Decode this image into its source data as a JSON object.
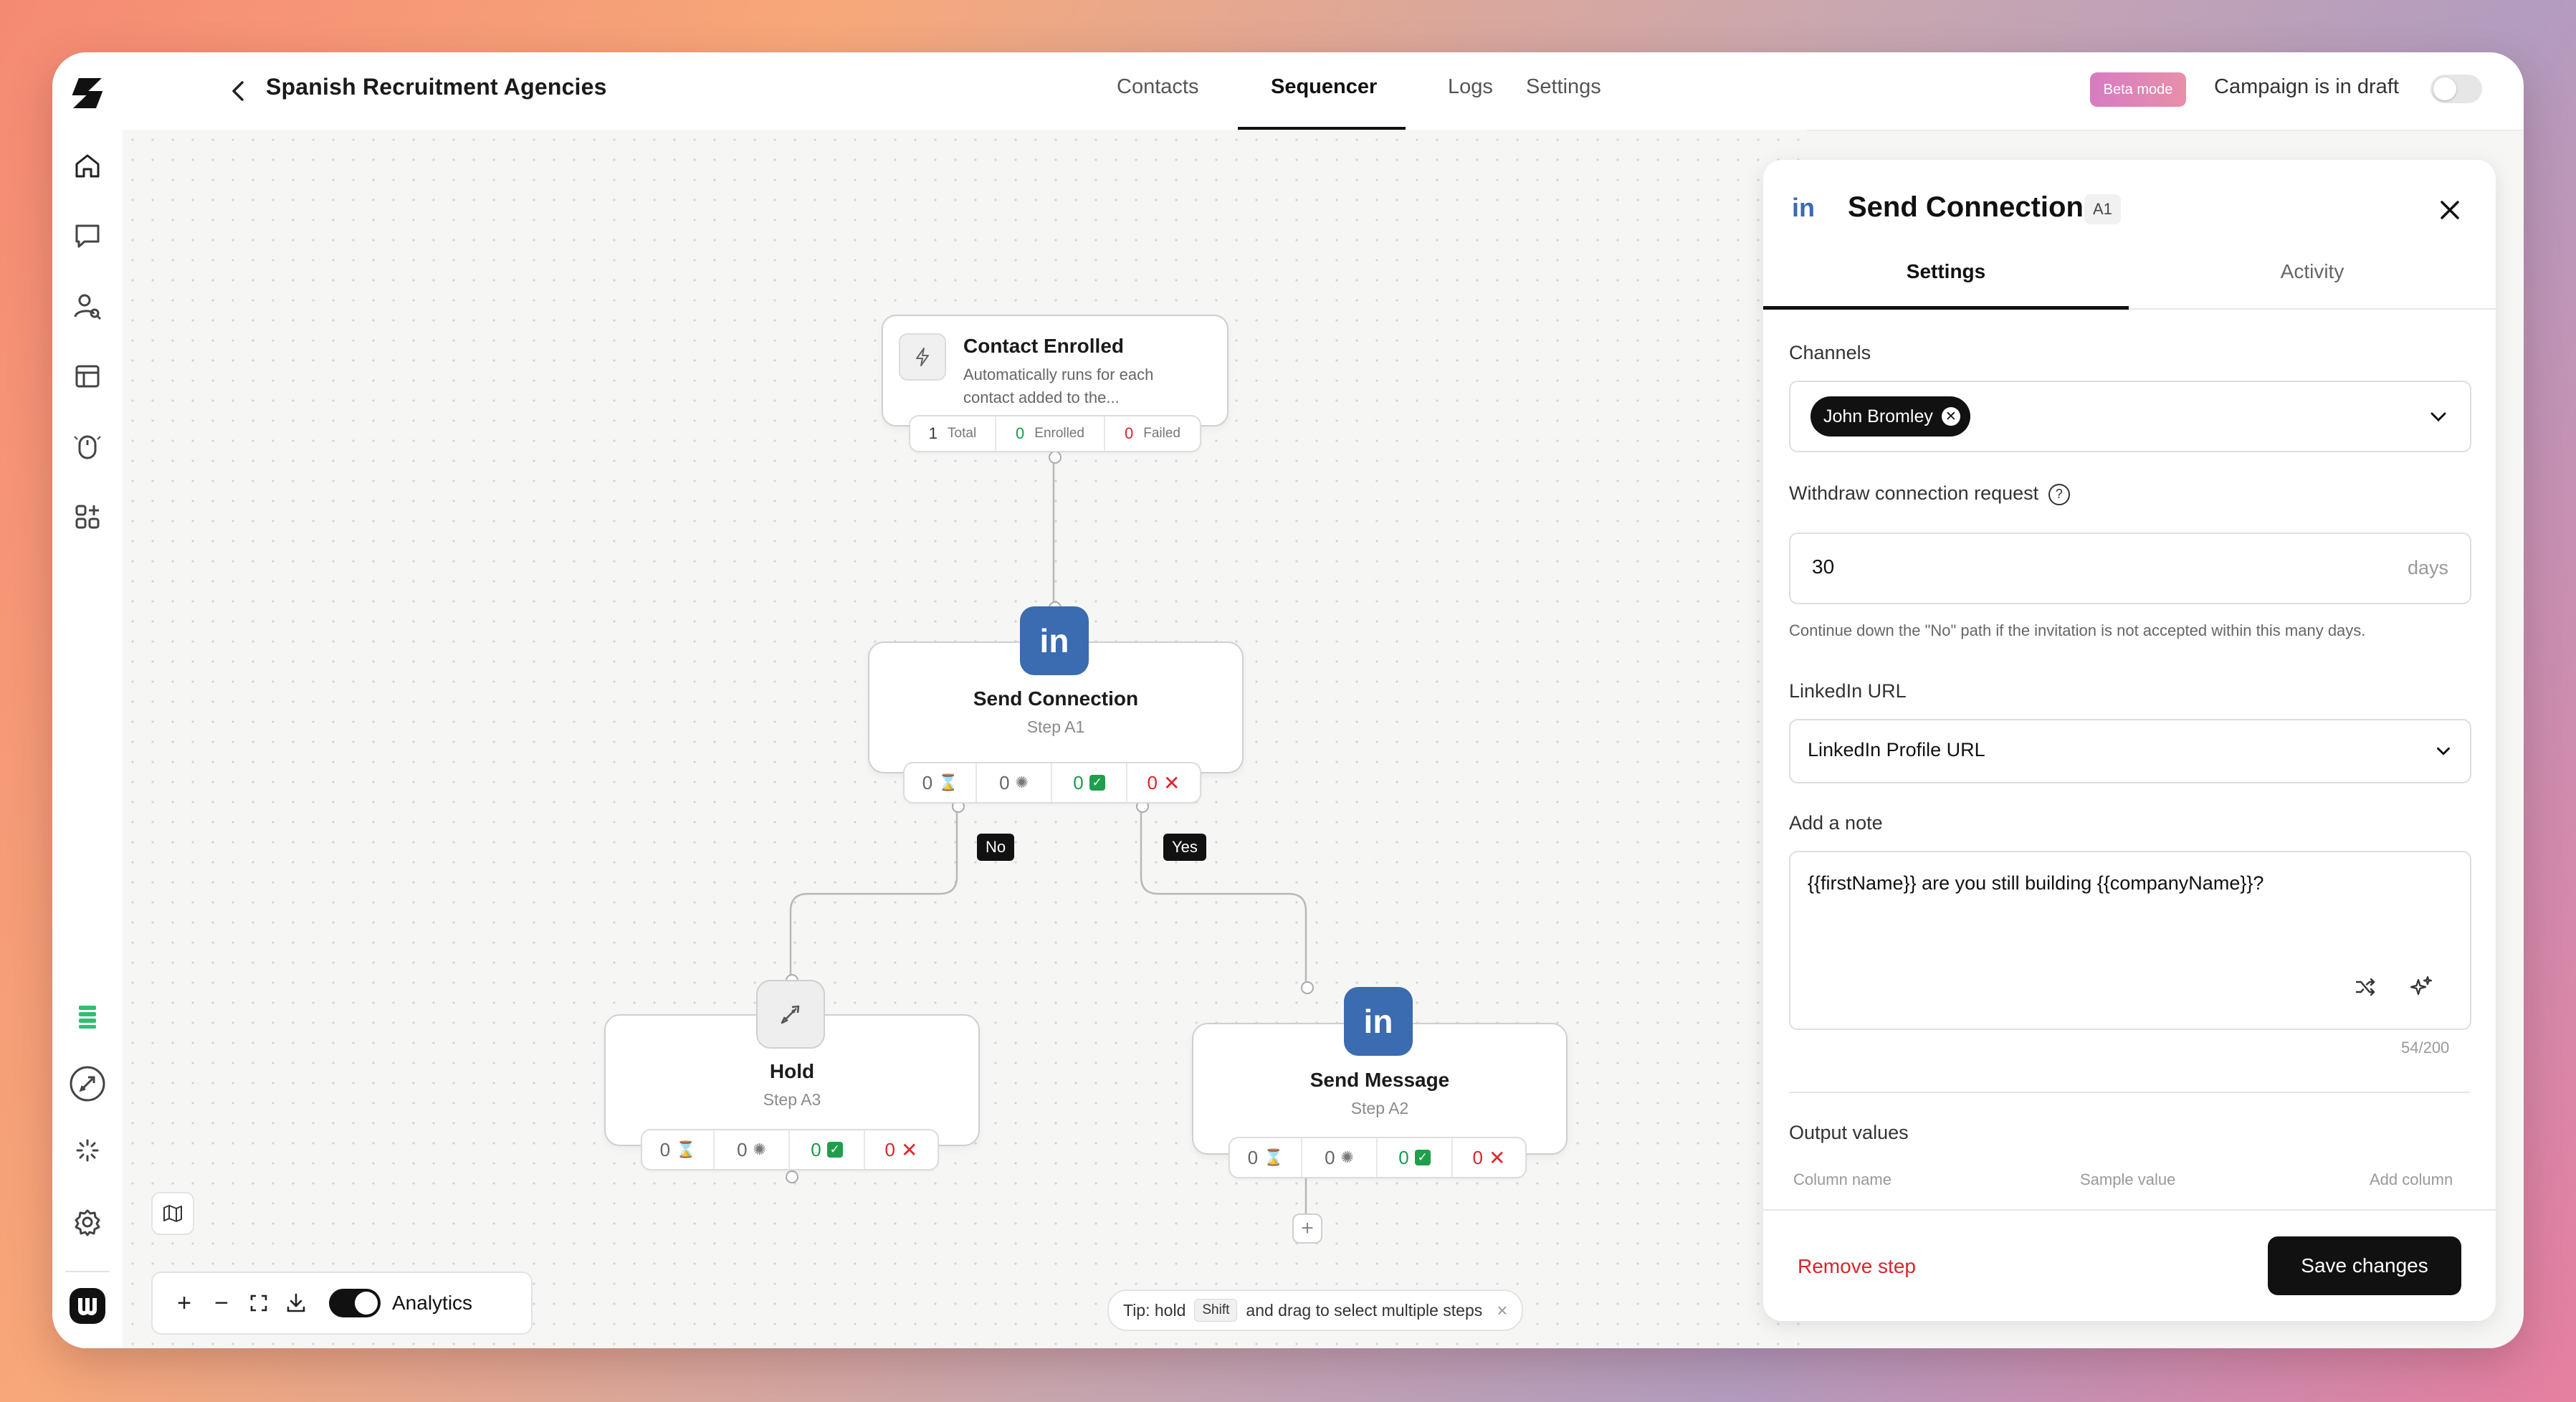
{
  "app": {
    "campaign_title": "Spanish Recruitment Agencies",
    "beta_badge": "Beta mode",
    "draft_status": "Campaign is in draft"
  },
  "tabs": [
    {
      "label": "Contacts",
      "active": false
    },
    {
      "label": "Sequencer",
      "active": true
    },
    {
      "label": "Logs",
      "active": false
    },
    {
      "label": "Settings",
      "active": false
    }
  ],
  "sidebar": {
    "icons": [
      "home-icon",
      "chat-icon",
      "contacts-icon",
      "table-icon",
      "mouse-icon",
      "apps-icon",
      "stack-icon",
      "rocket-icon",
      "sparkle-icon",
      "gear-icon",
      "workspace-avatar"
    ]
  },
  "canvas": {
    "trigger": {
      "title": "Contact Enrolled",
      "description": "Automatically runs for each contact added to the...",
      "total_value": "1",
      "total_label": "Total",
      "enrolled_value": "0",
      "enrolled_label": "Enrolled",
      "failed_value": "0",
      "failed_label": "Failed"
    },
    "send_connection": {
      "icon_text": "in",
      "title": "Send Connection",
      "step": "Step A1",
      "stats": [
        "0",
        "0",
        "0",
        "0"
      ]
    },
    "branch_no": "No",
    "branch_yes": "Yes",
    "hold": {
      "title": "Hold",
      "step": "Step A3",
      "stats": [
        "0",
        "0",
        "0",
        "0"
      ]
    },
    "send_message": {
      "icon_text": "in",
      "title": "Send Message",
      "step": "Step A2",
      "stats": [
        "0",
        "0",
        "0",
        "0"
      ]
    },
    "add_step": "+"
  },
  "controls": {
    "analytics_label": "Analytics",
    "analytics_on": true
  },
  "tip": {
    "prefix": "Tip: hold",
    "key": "Shift",
    "suffix": "and drag to select multiple steps",
    "close": "×"
  },
  "panel": {
    "icon_text": "in",
    "title": "Send Connection",
    "badge": "A1",
    "tabs": [
      {
        "label": "Settings",
        "active": true
      },
      {
        "label": "Activity",
        "active": false
      }
    ],
    "channels_label": "Channels",
    "channel_chip": "John Bromley",
    "withdraw_label": "Withdraw connection request",
    "withdraw_value": "30",
    "withdraw_unit": "days",
    "withdraw_help": "Continue down the \"No\" path if the invitation is not accepted within this many days.",
    "linkedin_url_label": "LinkedIn URL",
    "linkedin_url_value": "LinkedIn Profile URL",
    "note_label": "Add a note",
    "note_value": "{{firstName}} are you still building {{companyName}}?",
    "note_count": "54/200",
    "output_label": "Output values",
    "col_name": "Column name",
    "col_sample": "Sample value",
    "add_column": "Add column",
    "remove_step": "Remove step",
    "save_changes": "Save changes"
  },
  "colors": {
    "accent_dark": "#111111",
    "linkedin_blue": "#3b6bb0",
    "success_green": "#1a9b4c",
    "danger_red": "#d8252b",
    "beta_pink": "#d77bc3"
  }
}
